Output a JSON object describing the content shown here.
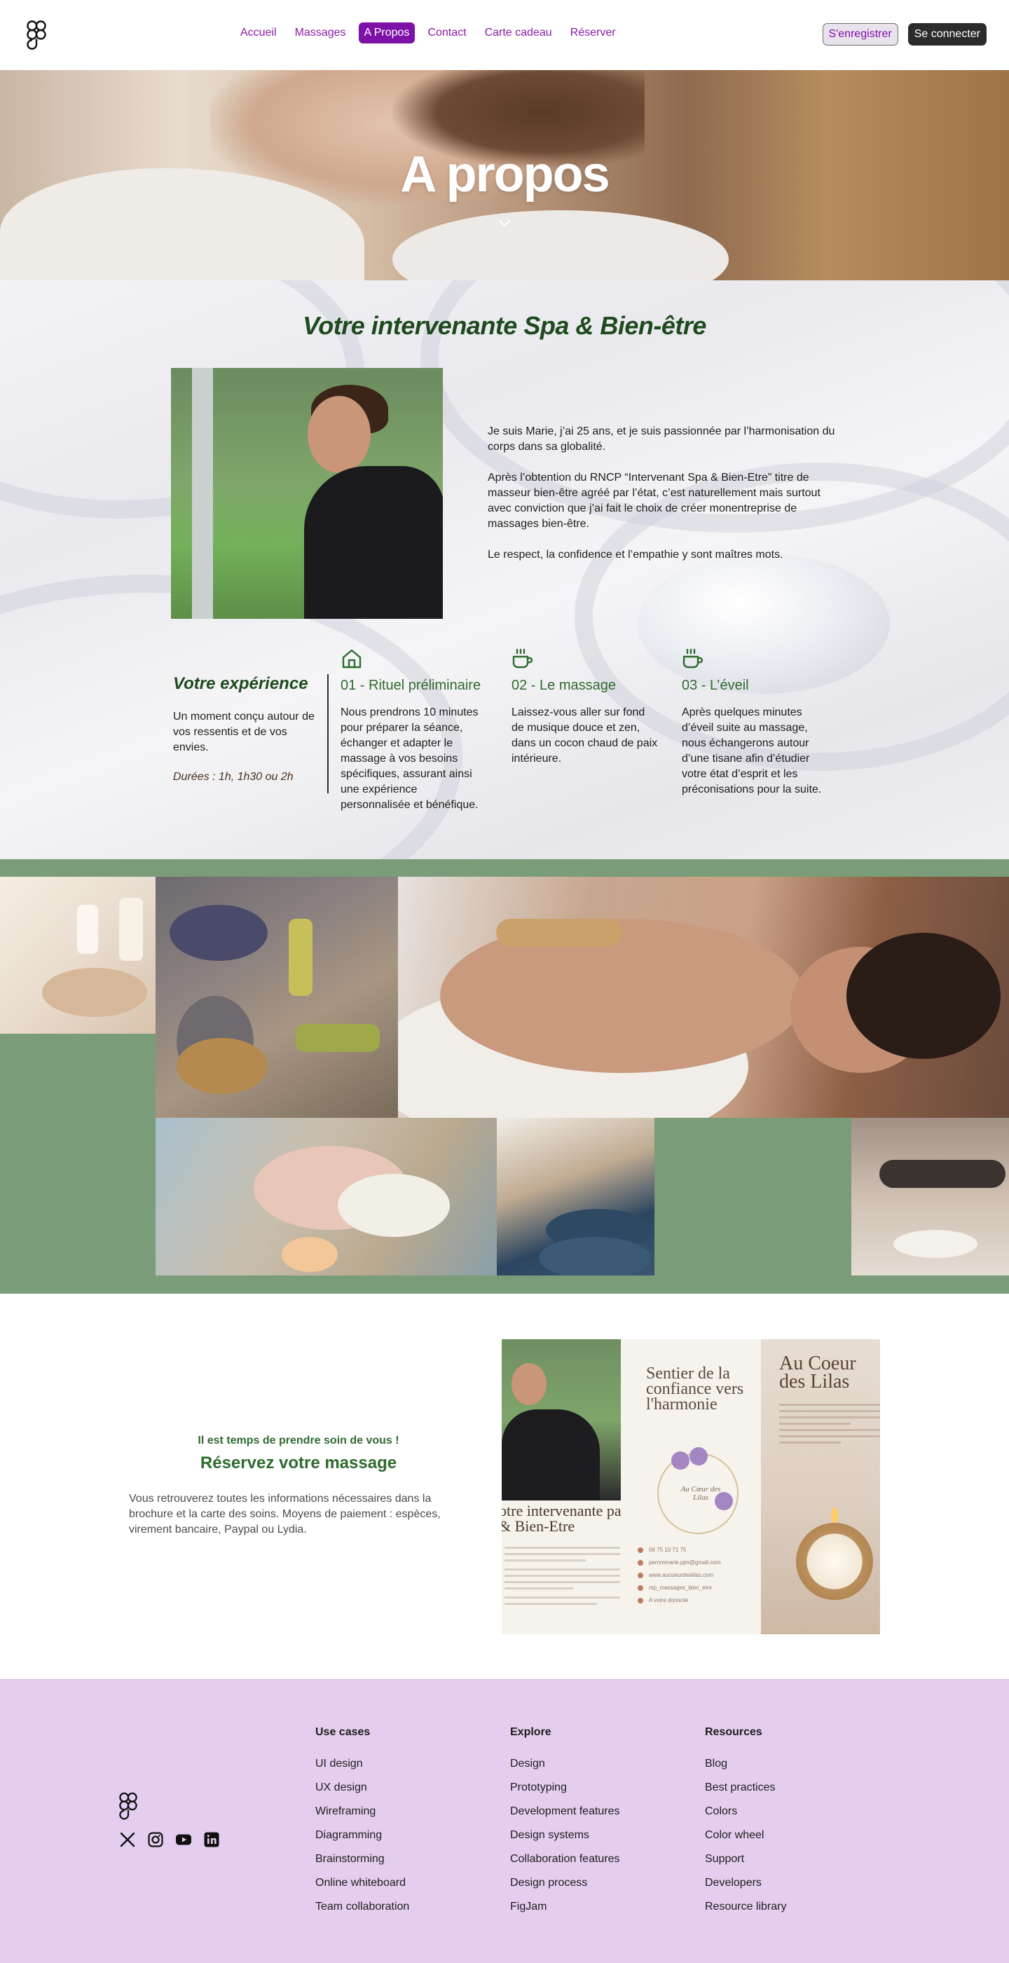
{
  "nav": {
    "links": [
      "Accueil",
      "Massages",
      "A Propos",
      "Contact",
      "Carte cadeau",
      "Réserver"
    ],
    "active_index": 2,
    "register_label": "S'enregistrer",
    "login_label": "Se connecter",
    "colors": {
      "accent": "#7e12a8",
      "dark_button": "#2c2c2c"
    }
  },
  "hero": {
    "title": "A propos",
    "chevron_icon": "chevron-down-icon"
  },
  "about": {
    "title": "Votre intervenante Spa & Bien-être",
    "paragraphs": [
      "Je suis Marie, j’ai 25 ans, et je suis passionnée par l’harmonisation du corps dans sa globalité.",
      "Après l’obtention du RNCP “Intervenant Spa & Bien-Etre” titre de masseur bien-être agréé par l’état, c’est naturellement mais surtout avec conviction que j’ai fait le choix de créer monentreprise de massages bien-être.",
      "Le respect, la confidence et l’empathie y sont maîtres mots."
    ],
    "experience": {
      "title": "Votre expérience",
      "description": "Un moment conçu autour de vos ressentis et de vos envies.",
      "durations": "Durées : 1h, 1h30 ou 2h"
    },
    "steps": [
      {
        "icon": "home-icon",
        "title": "01 - Rituel préliminaire",
        "description": "Nous prendrons 10 minutes pour préparer la séance, échanger et adapter le massage à vos besoins spécifiques, assurant ainsi une expérience personnalisée et bénéfique."
      },
      {
        "icon": "coffee-cup-icon",
        "title": "02 - Le massage",
        "description": "Laissez-vous aller sur fond de musique douce et zen, dans un cocon chaud de paix intérieure."
      },
      {
        "icon": "coffee-cup-icon",
        "title": "03 - L’éveil",
        "description": "Après quelques minutes d’éveil suite au massage, nous échangerons autour d’une tisane afin d’étudier votre état d’esprit et les préconisations pour la suite."
      }
    ],
    "colors": {
      "title_green": "#1e4a1e",
      "step_green": "#2f6a2f"
    }
  },
  "gallery": {
    "background": "#7a9c78",
    "images": [
      "candles-photo",
      "essential-oils-photo",
      "back-massage-photo",
      "hand-flowers-photo",
      "rolled-towels-photo",
      "hot-stones-photo"
    ]
  },
  "reserve": {
    "kicker": "Il est temps de prendre soin de vous !",
    "title": "Réservez votre massage",
    "description": "Vous retrouverez toutes les informations nécessaires dans la brochure et la carte des soins. Moyens de paiement : espèces, virement bancaire, Paypal ou Lydia.",
    "brochure": {
      "left_title": "otre intervenante pa & Bien-Etre",
      "middle_title": "Sentier de la confiance vers l'harmonie",
      "wreath_text": "Au Cœur des Lilas",
      "contacts": [
        "06 75 10 71 75",
        "pernmmarie.pjm@gmail.com",
        "www.aucoeurdeslilas.com",
        "mp_massages_bien_etre",
        "A votre domicile"
      ],
      "right_title": "Au Coeur des Lilas"
    }
  },
  "footer": {
    "social_icons": [
      "x-twitter-icon",
      "instagram-icon",
      "youtube-icon",
      "linkedin-icon"
    ],
    "columns": [
      {
        "title": "Use cases",
        "links": [
          "UI design",
          "UX design",
          "Wireframing",
          "Diagramming",
          "Brainstorming",
          "Online whiteboard",
          "Team collaboration"
        ]
      },
      {
        "title": "Explore",
        "links": [
          "Design",
          "Prototyping",
          "Development features",
          "Design systems",
          "Collaboration features",
          "Design process",
          "FigJam"
        ]
      },
      {
        "title": "Resources",
        "links": [
          "Blog",
          "Best practices",
          "Colors",
          "Color wheel",
          "Support",
          "Developers",
          "Resource library"
        ]
      }
    ],
    "background": "#e4cdee"
  }
}
